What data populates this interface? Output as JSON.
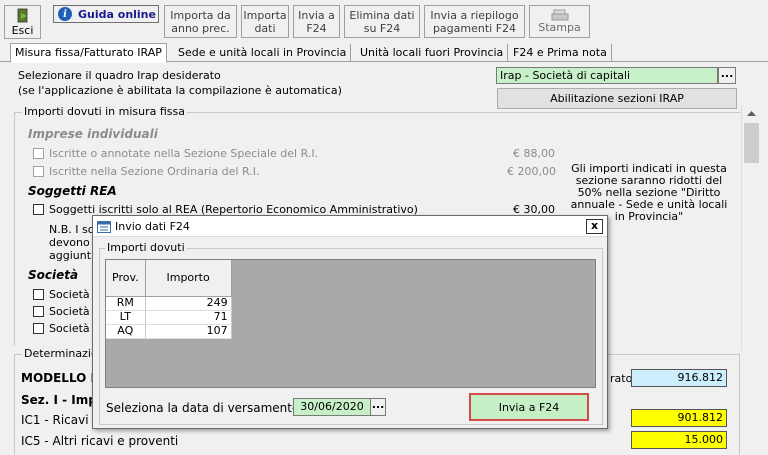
{
  "toolbar": {
    "esci": "Esci",
    "guida": "Guida online",
    "buttons": [
      {
        "label": "Importa da\nanno prec."
      },
      {
        "label": "Importa\ndati"
      },
      {
        "label": "Invia a\nF24"
      },
      {
        "label": "Elimina dati\nsu F24"
      },
      {
        "label": "Invia a riepilogo\npagamenti F24"
      },
      {
        "label": "Stampa"
      }
    ]
  },
  "tabs": [
    "Misura fissa/Fatturato IRAP",
    "Sede e unità locali in Provincia",
    "Unità locali fuori Provincia",
    "F24 e Prima nota"
  ],
  "main": {
    "select_label_1": "Selezionare il quadro Irap desiderato",
    "select_label_2": "(se l'applicazione è abilitata la compilazione è automatica)",
    "quadro_value": "Irap - Società di capitali",
    "abilitazione_button": "Abilitazione sezioni IRAP",
    "section_title": "Importi dovuti in misura fissa",
    "imprese_title": "Imprese individuali",
    "iscritte_1": "Iscritte o annotate nella Sezione Speciale del R.I.",
    "iscritte_1_amount": "€ 88,00",
    "iscritte_2": "Iscritte nella Sezione Ordinaria del R.I.",
    "iscritte_2_amount": "€ 200,00",
    "rea_title": "Soggetti REA",
    "rea_item": "Soggetti iscritti solo al REA (Repertorio Economico Amministrativo)",
    "rea_amount": "€ 30,00",
    "nb_line1": "N.B. I so",
    "nb_line2": "devono",
    "nb_line3": "aggiunt",
    "note": "Gli importi indicati in questa sezione saranno ridotti del 50% nella sezione \"Diritto annuale - Sede e unità locali in Provincia\"",
    "societa_title": "Società",
    "societa_items": [
      "Società",
      "Società",
      "Società"
    ],
    "determinazione": "Determinazio",
    "modello": "MODELLO II",
    "ato_label": "rato",
    "ato_value": "916.812",
    "sez": "Sez. I - Impo",
    "ic1": "IC1 - Ricavi d",
    "ic1_value": "901.812",
    "ic5": "IC5 - Altri ricavi e proventi",
    "ic5_value": "15.000"
  },
  "dialog": {
    "title": "Invio dati F24",
    "close": "x",
    "group": "Importi dovuti",
    "columns": [
      "Prov.",
      "Importo"
    ],
    "rows": [
      {
        "prov": "RM",
        "importo": "249"
      },
      {
        "prov": "LT",
        "importo": "71"
      },
      {
        "prov": "AQ",
        "importo": "107"
      }
    ],
    "date_label": "Seleziona la data di versamento",
    "date_value": "30/06/2020",
    "send_button": "Invia a F24"
  }
}
